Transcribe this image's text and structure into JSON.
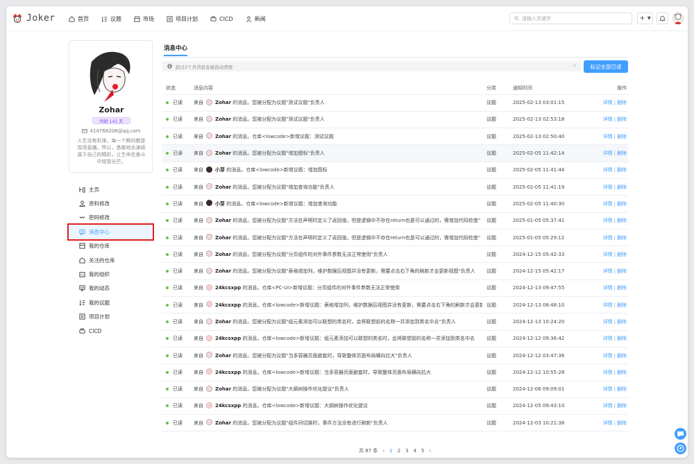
{
  "app": {
    "logo_text": "Joker"
  },
  "nav": [
    {
      "label": "首页",
      "icon": "home-icon"
    },
    {
      "label": "议题",
      "icon": "issue-icon"
    },
    {
      "label": "市场",
      "icon": "market-icon"
    },
    {
      "label": "项目计划",
      "icon": "plan-icon"
    },
    {
      "label": "CICD",
      "icon": "cicd-icon"
    },
    {
      "label": "新闻",
      "icon": "news-icon"
    }
  ],
  "search": {
    "placeholder": "请输入关键字"
  },
  "header": {
    "plus_label": "+ ▾"
  },
  "profile": {
    "name": "Zohar",
    "age_badge": "码龄 141 天",
    "email": "414768208@qq.com",
    "bio": "人生没有彩排，每一个瞬间都是现场直播。所以，勇敢地去演绎属于自己的精彩，让生命在奋斗中绽放光芒。"
  },
  "sidemenu": [
    {
      "label": "主页",
      "icon": "profile-home-icon"
    },
    {
      "label": "资料修改",
      "icon": "user-icon"
    },
    {
      "label": "密码修改",
      "icon": "password-icon"
    },
    {
      "label": "消息中心",
      "icon": "message-icon",
      "active": true
    },
    {
      "label": "我的仓库",
      "icon": "repo-icon"
    },
    {
      "label": "关注的仓库",
      "icon": "star-repo-icon"
    },
    {
      "label": "我的组织",
      "icon": "org-icon"
    },
    {
      "label": "我的动态",
      "icon": "activity-icon"
    },
    {
      "label": "我的议题",
      "icon": "my-issue-icon"
    },
    {
      "label": "项目计划",
      "icon": "plan-icon"
    },
    {
      "label": "CICD",
      "icon": "cicd-icon"
    }
  ],
  "main": {
    "tab": "消息中心",
    "notice": "超过3个月消息会被自动清理",
    "mark_all_label": "标记全部已读",
    "columns": {
      "status": "状态",
      "content": "消息内容",
      "category": "分类",
      "time": "通知时间",
      "action": "操作"
    },
    "row_prefix": "来自",
    "action_detail": "详情",
    "action_delete": "删除",
    "rows": [
      {
        "status": "已读",
        "actor": "Zohar",
        "text": "的消息。您被分配为议题\"测试议题\"负责人",
        "category": "议题",
        "time": "2025-02-13 03:01:15",
        "avatar": "z",
        "hl": false
      },
      {
        "status": "已读",
        "actor": "Zohar",
        "text": "的消息。您被分配为议题\"测试议题\"负责人",
        "category": "议题",
        "time": "2025-02-13 02:53:18",
        "avatar": "z",
        "hl": false
      },
      {
        "status": "已读",
        "actor": "Zohar",
        "text": "的消息。仓库<lowcode>新增议题：测试议题",
        "category": "议题",
        "time": "2025-02-13 02:50:40",
        "avatar": "z",
        "hl": false
      },
      {
        "status": "已读",
        "actor": "Zohar",
        "text": "的消息。您被分配为议题\"增加图标\"负责人",
        "category": "议题",
        "time": "2025-02-05 11:42:14",
        "avatar": "z",
        "hl": true
      },
      {
        "status": "已读",
        "actor": "小芽",
        "text": "的消息。仓库<lowcode>新增议题：增加图标",
        "category": "议题",
        "time": "2025-02-05 11:41:44",
        "avatar": "x",
        "hl": false
      },
      {
        "status": "已读",
        "actor": "Zohar",
        "text": "的消息。您被分配为议题\"增加查询功能\"负责人",
        "category": "议题",
        "time": "2025-02-05 11:41:19",
        "avatar": "z",
        "hl": false
      },
      {
        "status": "已读",
        "actor": "小芽",
        "text": "的消息。仓库<lowcode>新增议题：增加查询功能",
        "category": "议题",
        "time": "2025-02-05 11:40:30",
        "avatar": "x",
        "hl": false
      },
      {
        "status": "已读",
        "actor": "Zohar",
        "text": "的消息。您被分配为议题\"方法在声明时定义了返回值，但是逻辑中不存在return也是可以通过的，需增加代码检查\"",
        "category": "议题",
        "time": "2025-01-05 05:37:41",
        "avatar": "z",
        "hl": false
      },
      {
        "status": "已读",
        "actor": "Zohar",
        "text": "的消息。您被分配为议题\"方法在声明时定义了返回值，但是逻辑中不存在return也是可以通过的，需增加代码检查\"",
        "category": "议题",
        "time": "2025-01-05 05:29:12",
        "avatar": "z",
        "hl": false
      },
      {
        "status": "已读",
        "actor": "Zohar",
        "text": "的消息。您被分配为议题\"分页组件的对外事件参数无法正常使用\"负责人",
        "category": "议题",
        "time": "2024-12-15 05:42:33",
        "avatar": "z",
        "hl": false
      },
      {
        "status": "已读",
        "actor": "Zohar",
        "text": "的消息。您被分配为议题\"表格增加列，维护数据后视图并没有更新，需要点击右下角的刷新才会更新视图\"负责人",
        "category": "议题",
        "time": "2024-12-15 05:42:17",
        "avatar": "z",
        "hl": false
      },
      {
        "status": "已读",
        "actor": "24kcsxpp",
        "text": "的消息。仓库<PC-UI>新增议题：分页组件的对外事件参数无法正常使用",
        "category": "议题",
        "time": "2024-12-13 09:47:55",
        "avatar": "k",
        "hl": false
      },
      {
        "status": "已读",
        "actor": "24kcsxpp",
        "text": "的消息。仓库<lowcode>新增议题：表格增加列，维护数据后视图并没有更新，需要点击右下角的刷新才会更新视图",
        "category": "议题",
        "time": "2024-12-13 08:48:10",
        "avatar": "k",
        "hl": false
      },
      {
        "status": "已读",
        "actor": "Zohar",
        "text": "的消息。您被分配为议题\"组元素添加可以联想的类名时，会将联想前的名称一并添加到类名中去\"负责人",
        "category": "议题",
        "time": "2024-12-13 10:24:20",
        "avatar": "z",
        "hl": false
      },
      {
        "status": "已读",
        "actor": "24kcsxpp",
        "text": "的消息。仓库<lowcode>新增议题：组元素添加可以联想的类名时，会将联想前的名称一并添加到类名中去",
        "category": "议题",
        "time": "2024-12-12 09:36:42",
        "avatar": "k",
        "hl": false
      },
      {
        "status": "已读",
        "actor": "Zohar",
        "text": "的消息。您被分配为议题\"当多容器页面嵌套时，导致整体页面布局横向拉大\"负责人",
        "category": "议题",
        "time": "2024-12-12 03:47:36",
        "avatar": "z",
        "hl": false
      },
      {
        "status": "已读",
        "actor": "24kcsxpp",
        "text": "的消息。仓库<lowcode>新增议题：当多容器页面嵌套时，导致整体页面布局横向拉大",
        "category": "议题",
        "time": "2024-12-12 10:55:28",
        "avatar": "k",
        "hl": false
      },
      {
        "status": "已读",
        "actor": "Zohar",
        "text": "的消息。您被分配为议题\"大纲树操作优化提议\"负责人",
        "category": "议题",
        "time": "2024-12-06 09:09:01",
        "avatar": "z",
        "hl": false
      },
      {
        "status": "已读",
        "actor": "24kcsxpp",
        "text": "的消息。仓库<lowcode>新增议题：大纲树操作优化提议",
        "category": "议题",
        "time": "2024-12-05 09:43:10",
        "avatar": "k",
        "hl": false
      },
      {
        "status": "已读",
        "actor": "Zohar",
        "text": "的消息。您被分配为议题\"组件间切换时，事件方法没有进行刷新\"负责人",
        "category": "议题",
        "time": "2024-12-03 10:21:38",
        "avatar": "z",
        "hl": false
      }
    ]
  },
  "pagination": {
    "total": "共 87 条",
    "prev": "‹",
    "next": "›",
    "pages": [
      "1",
      "2",
      "3",
      "4",
      "5"
    ],
    "current": "1"
  },
  "colors": {
    "accent": "#409eff",
    "active_outline": "#e02020",
    "read_dot": "#67c23a",
    "badge": "#7c4dff"
  }
}
